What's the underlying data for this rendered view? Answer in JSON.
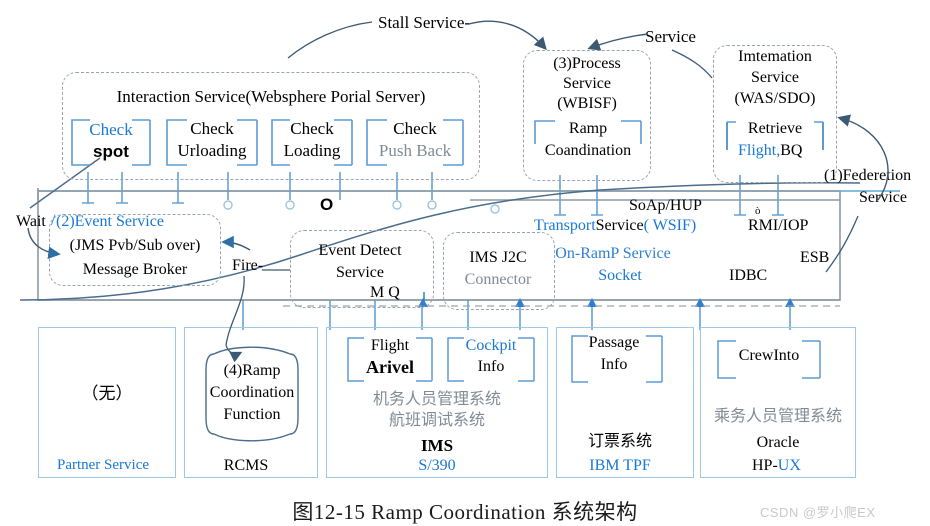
{
  "figure": {
    "caption": "图12-15 Ramp Coordination 系统架构",
    "watermark": "CSDN @罗小爬EX"
  },
  "colors": {
    "accent_blue": "#1878d6",
    "light_blue": "#5b9bd5",
    "gray_dash": "#9aa4ad",
    "gray_solid": "#8c9aa4",
    "box_blue": "#9ec8e8",
    "gray_text": "#7f8b96",
    "arrow": "#46617e"
  },
  "annotations": {
    "stall_service": "Stall Service-",
    "service": "Service",
    "wait": "Wait",
    "fire": "Fire-",
    "federation_service_line1": "(1)Federetion",
    "federation_service_line2": "Service",
    "esb": "ESB",
    "o_marker": "O"
  },
  "interaction_service": {
    "title": "Interaction Service(Websphere Porial Server)",
    "portlets": [
      {
        "line1": "Check",
        "line1_color": "blue",
        "line2": "spot",
        "line2_style": "bold-sans"
      },
      {
        "line1": "Check",
        "line1_color": "black",
        "line2": "Urloading",
        "line2_style": "serif"
      },
      {
        "line1": "Check",
        "line1_color": "black",
        "line2": "Loading",
        "line2_style": "serif"
      },
      {
        "line1": "Check",
        "line1_color": "black",
        "line2": "Push Back",
        "line2_style": "serif"
      }
    ]
  },
  "process_service": {
    "line1": "(3)Process",
    "line2": "Service",
    "line3": "(WBISF)",
    "inner_line1": "Ramp",
    "inner_line2": "Coandination"
  },
  "information_service": {
    "line1": "Imtemation",
    "line2": "Service",
    "line3": "(WAS/SDO)",
    "inner_line1": "Retrieve",
    "inner_line2_blue": "Flight,",
    "inner_line2_black": "BQ"
  },
  "event_service": {
    "title_num": "(2)",
    "title": "Event Service",
    "line2": "(JMS Pvb/Sub over)",
    "line3": "Message Broker"
  },
  "event_detect": {
    "line1": "Event Detect",
    "line2": "Service",
    "line3": "M Q"
  },
  "ims_j2c": {
    "line1": "IMS J2C",
    "line2": "Connector"
  },
  "transport_service": {
    "soap_http": "SoAp/HUP",
    "transport": "Transport",
    "service": "Service",
    "wsif": "(  WSIF)",
    "rmi_iop": "RMI/IOP",
    "rmi_mark": "ò",
    "on_ramp": "On-RamP Service",
    "socket": "Socket",
    "jdbc": "IDBC"
  },
  "systems": [
    {
      "id": "partner-service",
      "center_text": "（无）",
      "footer": "Partner Service",
      "footer_color": "blue",
      "inner": null,
      "cn_lines": [],
      "extra_lines": []
    },
    {
      "id": "rcms",
      "center_text": null,
      "footer": "RCMS",
      "footer_color": "black",
      "inner": {
        "lines": [
          "(4)Ramp",
          "Coordination",
          "Function"
        ],
        "style": "brace"
      },
      "cn_lines": [],
      "extra_lines": []
    },
    {
      "id": "ims-s390",
      "center_text": null,
      "footer": "S/390",
      "footer_color": "blue",
      "inner": null,
      "brackets": [
        {
          "line1": "Flight",
          "line1_color": "black",
          "line2": "Arivel",
          "line2_style": "bold"
        },
        {
          "line1": "Cockpit",
          "line1_color": "blue",
          "line2": "Info",
          "line2_style": "serif"
        }
      ],
      "cn_lines": [
        "机务人员管理系统",
        "航班调试系统"
      ],
      "extra_lines": [
        "IMS"
      ]
    },
    {
      "id": "ticketing-ibm-tpf",
      "center_text": null,
      "footer": "IBM TPF",
      "footer_color": "blue",
      "brackets": [
        {
          "line1": "Passage",
          "line1_color": "black",
          "line2": "Info",
          "line2_style": "serif"
        }
      ],
      "cn_lines": [
        "订票系统"
      ],
      "extra_lines": []
    },
    {
      "id": "crew-oracle-hpux",
      "center_text": null,
      "footer_black": "HP-",
      "footer": "UX",
      "footer_color": "blue",
      "brackets": [
        {
          "line1": "CrewInto",
          "line1_color": "black",
          "line2": "",
          "line2_style": "serif"
        }
      ],
      "cn_lines": [
        "乘务人员管理系统"
      ],
      "extra_lines": [
        "Oracle"
      ]
    }
  ]
}
